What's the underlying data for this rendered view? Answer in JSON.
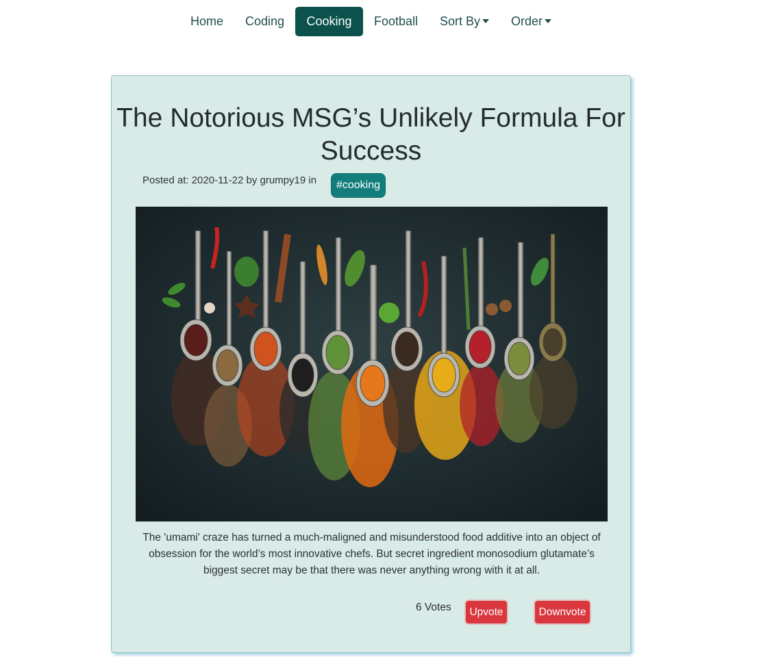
{
  "nav": {
    "items": [
      {
        "label": "Home",
        "active": false
      },
      {
        "label": "Coding",
        "active": false
      },
      {
        "label": "Cooking",
        "active": true
      },
      {
        "label": "Football",
        "active": false
      },
      {
        "label": "Sort By",
        "dropdown": true
      },
      {
        "label": "Order",
        "dropdown": true
      }
    ]
  },
  "post": {
    "title": "The Notorious MSG’s Unlikely Formula For Success",
    "meta": "Posted at: 2020-11-22 by grumpy19 in",
    "tag": "#cooking",
    "image_alt": "spices-on-spoons",
    "description": "The 'umami' craze has turned a much-maligned and misunderstood food additive into an object of obsession for the world’s most innovative chefs. But secret ingredient monosodium glutamate’s biggest secret may be that there was never anything wrong with it at all.",
    "votes": "6 Votes",
    "upvote_label": "Upvote",
    "downvote_label": "Downvote"
  },
  "colors": {
    "nav_active_bg": "#0b524c",
    "card_bg": "#d9ebe7",
    "tag_bg": "#127d7a",
    "button_bg": "#d9363e"
  }
}
